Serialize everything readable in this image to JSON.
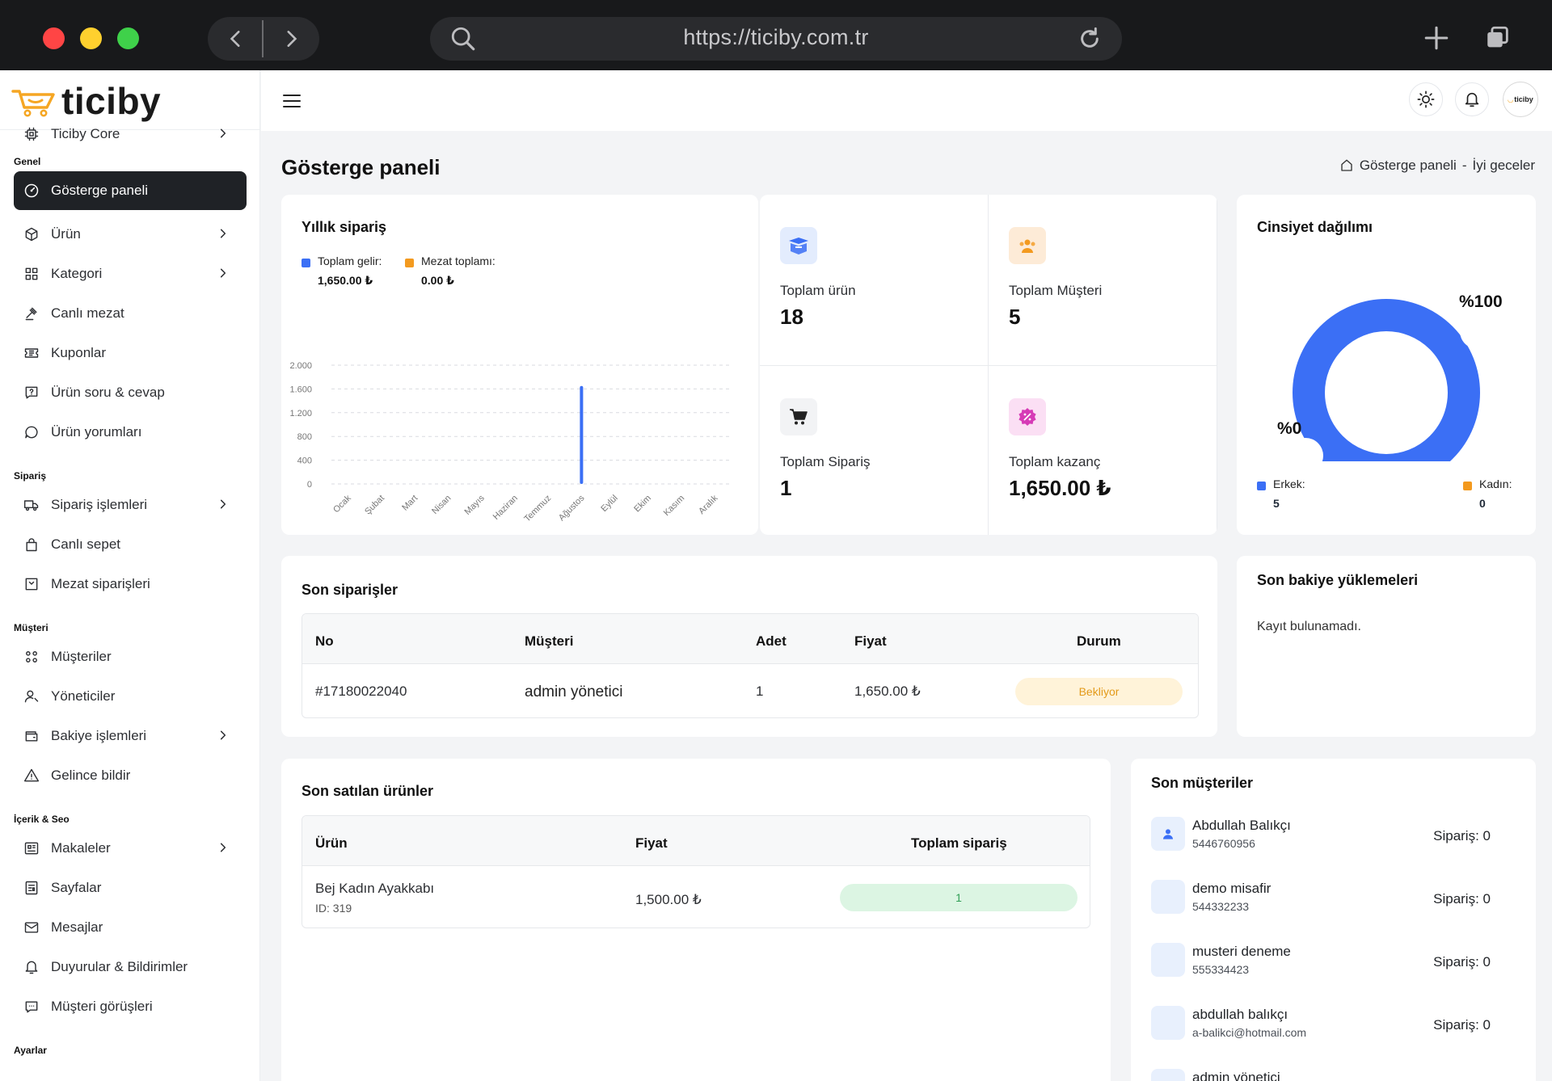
{
  "browser": {
    "url": "https://ticiby.com.tr"
  },
  "brand": {
    "name": "ticiby",
    "accent": "#f5a623"
  },
  "sidebar": {
    "top_item": {
      "label": "Ticiby Core"
    },
    "sections": [
      {
        "title": "Genel",
        "items": [
          {
            "label": "Gösterge paneli",
            "icon": "dashboard-icon",
            "active": true
          },
          {
            "label": "Ürün",
            "icon": "box-icon",
            "chevron": true
          },
          {
            "label": "Kategori",
            "icon": "grid-icon",
            "chevron": true
          },
          {
            "label": "Canlı mezat",
            "icon": "gavel-icon"
          },
          {
            "label": "Kuponlar",
            "icon": "ticket-icon"
          },
          {
            "label": "Ürün soru & cevap",
            "icon": "question-icon"
          },
          {
            "label": "Ürün yorumları",
            "icon": "comment-icon"
          }
        ]
      },
      {
        "title": "Sipariş",
        "items": [
          {
            "label": "Sipariş işlemleri",
            "icon": "truck-icon",
            "chevron": true
          },
          {
            "label": "Canlı sepet",
            "icon": "bag-icon"
          },
          {
            "label": "Mezat siparişleri",
            "icon": "inbox-icon"
          }
        ]
      },
      {
        "title": "Müşteri",
        "items": [
          {
            "label": "Müşteriler",
            "icon": "users-icon"
          },
          {
            "label": "Yöneticiler",
            "icon": "user-cog-icon"
          },
          {
            "label": "Bakiye işlemleri",
            "icon": "wallet-icon",
            "chevron": true
          },
          {
            "label": "Gelince bildir",
            "icon": "alert-icon"
          }
        ]
      },
      {
        "title": "İçerik & Seo",
        "items": [
          {
            "label": "Makaleler",
            "icon": "article-icon",
            "chevron": true
          },
          {
            "label": "Sayfalar",
            "icon": "page-icon"
          },
          {
            "label": "Mesajlar",
            "icon": "mail-icon"
          },
          {
            "label": "Duyurular & Bildirimler",
            "icon": "bell-icon"
          },
          {
            "label": "Müşteri görüşleri",
            "icon": "chat-icon"
          }
        ]
      },
      {
        "title": "Ayarlar",
        "items": []
      }
    ]
  },
  "header": {
    "avatar_text": "ticiby"
  },
  "page": {
    "title": "Gösterge paneli",
    "breadcrumb": {
      "current": "Gösterge paneli",
      "separator": "-",
      "greeting": "İyi geceler"
    }
  },
  "yearly": {
    "title": "Yıllık sipariş",
    "legend": [
      {
        "label": "Toplam gelir:",
        "value": "1,650.00 ₺",
        "color": "#3b6ff5"
      },
      {
        "label": "Mezat toplamı:",
        "value": "0.00 ₺",
        "color": "#f39a1f"
      }
    ]
  },
  "chart_data": {
    "type": "bar",
    "categories": [
      "Ocak",
      "Şubat",
      "Mart",
      "Nisan",
      "Mayıs",
      "Haziran",
      "Temmuz",
      "Ağustos",
      "Eylül",
      "Ekim",
      "Kasım",
      "Aralık"
    ],
    "series": [
      {
        "name": "Toplam gelir",
        "values": [
          0,
          0,
          0,
          0,
          0,
          0,
          0,
          1650,
          0,
          0,
          0,
          0
        ],
        "color": "#3b6ff5"
      },
      {
        "name": "Mezat toplamı",
        "values": [
          0,
          0,
          0,
          0,
          0,
          0,
          0,
          0,
          0,
          0,
          0,
          0
        ],
        "color": "#f39a1f"
      }
    ],
    "yticks": [
      "0",
      "400",
      "800",
      "1.200",
      "1.600",
      "2.000"
    ],
    "ytick_values": [
      0,
      400,
      800,
      1200,
      1600,
      2000
    ],
    "ylim": [
      0,
      2000
    ],
    "grid": true
  },
  "stats": [
    {
      "label": "Toplam ürün",
      "value": "18",
      "icon": "package-icon",
      "bg": "#e3ecfd",
      "fg": "#3b6ff5"
    },
    {
      "label": "Toplam Müşteri",
      "value": "5",
      "icon": "customers-icon",
      "bg": "#fdebd7",
      "fg": "#f39a1f"
    },
    {
      "label": "Toplam Sipariş",
      "value": "1",
      "icon": "cart-icon",
      "bg": "#f2f3f5",
      "fg": "#222"
    },
    {
      "label": "Toplam kazanç",
      "value": "1,650.00 ₺",
      "icon": "discount-icon",
      "bg": "#fbdff4",
      "fg": "#d63ab6"
    }
  ],
  "gender": {
    "title": "Cinsiyet dağılımı",
    "labels": {
      "male_pct": "%0",
      "female_pct": "%100"
    },
    "legend": [
      {
        "label": "Erkek:",
        "value": "5",
        "color": "#3b6ff5"
      },
      {
        "label": "Kadın:",
        "value": "0",
        "color": "#f39a1f"
      }
    ],
    "share": 1.0,
    "ring_color": "#3b6ff5"
  },
  "recent_orders": {
    "title": "Son siparişler",
    "columns": [
      "No",
      "Müşteri",
      "Adet",
      "Fiyat",
      "Durum"
    ],
    "rows": [
      {
        "no": "#17180022040",
        "customer": "admin yönetici",
        "qty": "1",
        "price": "1,650.00 ₺",
        "status": "Bekliyor"
      }
    ]
  },
  "balance": {
    "title": "Son bakiye yüklemeleri",
    "empty": "Kayıt bulunamadı."
  },
  "sold_products": {
    "title": "Son satılan ürünler",
    "columns": [
      "Ürün",
      "Fiyat",
      "Toplam sipariş"
    ],
    "rows": [
      {
        "name": "Bej Kadın Ayakkabı",
        "id": "ID: 319",
        "price": "1,500.00 ₺",
        "count": "1"
      }
    ]
  },
  "customers": {
    "title": "Son müşteriler",
    "items": [
      {
        "name": "Abdullah Balıkçı",
        "contact": "5446760956",
        "orders": "Sipariş: 0",
        "has_icon": true
      },
      {
        "name": "demo misafir",
        "contact": "544332233",
        "orders": "Sipariş: 0"
      },
      {
        "name": "musteri deneme",
        "contact": "555334423",
        "orders": "Sipariş: 0"
      },
      {
        "name": "abdullah balıkçı",
        "contact": "a-balikci@hotmail.com",
        "orders": "Sipariş: 0"
      },
      {
        "name": "admin yönetici",
        "contact": "",
        "orders": ""
      }
    ]
  }
}
